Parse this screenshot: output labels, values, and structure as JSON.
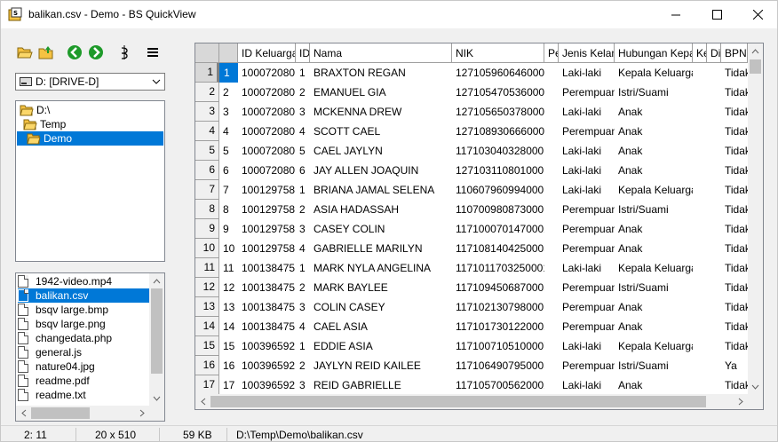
{
  "window": {
    "title": "balikan.csv - Demo - BS QuickView"
  },
  "toolbar": {
    "buttons": [
      "open-folder-icon",
      "up-folder-icon",
      "back-icon",
      "forward-icon",
      "wrap-icon",
      "menu-icon"
    ]
  },
  "drive": {
    "selected": "D: [DRIVE-D]"
  },
  "tree": {
    "items": [
      {
        "label": "D:\\",
        "depth": 0,
        "selected": false
      },
      {
        "label": "Temp",
        "depth": 1,
        "selected": false
      },
      {
        "label": "Demo",
        "depth": 2,
        "selected": true
      }
    ]
  },
  "files": {
    "items": [
      {
        "label": "1942-video.mp4",
        "selected": false
      },
      {
        "label": "balikan.csv",
        "selected": true
      },
      {
        "label": "bsqv large.bmp",
        "selected": false
      },
      {
        "label": "bsqv large.png",
        "selected": false
      },
      {
        "label": "changedata.php",
        "selected": false
      },
      {
        "label": "general.js",
        "selected": false
      },
      {
        "label": "nature04.jpg",
        "selected": false
      },
      {
        "label": "readme.pdf",
        "selected": false
      },
      {
        "label": "readme.txt",
        "selected": false
      }
    ]
  },
  "grid": {
    "columns": [
      "ID Keluarga",
      "ID",
      "Nama",
      "NIK",
      "Pe",
      "Jenis Kelamin",
      "Hubungan Kepala Keluarga",
      "Ke",
      "Di",
      "BPNT"
    ],
    "rows": [
      {
        "n": "1",
        "cells": [
          "1",
          "100072080",
          "1",
          "BRAXTON REGAN",
          "1271059606460001",
          "",
          "Laki-laki",
          "Kepala Keluarga",
          "",
          "",
          "Tidak"
        ]
      },
      {
        "n": "2",
        "cells": [
          "2",
          "100072080",
          "2",
          "EMANUEL GIA",
          "1271054705360001",
          "",
          "Perempuan",
          "Istri/Suami",
          "",
          "",
          "Tidak"
        ]
      },
      {
        "n": "3",
        "cells": [
          "3",
          "100072080",
          "3",
          "MCKENNA DREW",
          "1271056503780001",
          "",
          "Laki-laki",
          "Anak",
          "",
          "",
          "Tidak"
        ]
      },
      {
        "n": "4",
        "cells": [
          "4",
          "100072080",
          "4",
          "SCOTT CAEL",
          "1271089306660001",
          "",
          "Perempuan",
          "Anak",
          "",
          "",
          "Tidak"
        ]
      },
      {
        "n": "5",
        "cells": [
          "5",
          "100072080",
          "5",
          "CAEL JAYLYN",
          "1171030403280001",
          "",
          "Laki-laki",
          "Anak",
          "",
          "",
          "Tidak"
        ]
      },
      {
        "n": "6",
        "cells": [
          "6",
          "100072080",
          "6",
          "JAY ALLEN JOAQUIN",
          "1271031108010001",
          "",
          "Laki-laki",
          "Anak",
          "",
          "",
          "Tidak"
        ]
      },
      {
        "n": "7",
        "cells": [
          "7",
          "100129758",
          "1",
          "BRIANA JAMAL SELENA",
          "1106079609940001",
          "",
          "Laki-laki",
          "Kepala Keluarga",
          "",
          "",
          "Tidak"
        ]
      },
      {
        "n": "8",
        "cells": [
          "8",
          "100129758",
          "2",
          "ASIA HADASSAH",
          "1107009808730001",
          "",
          "Perempuan",
          "Istri/Suami",
          "",
          "",
          "Tidak"
        ]
      },
      {
        "n": "9",
        "cells": [
          "9",
          "100129758",
          "3",
          "CASEY COLIN",
          "1171000701470002",
          "",
          "Perempuan",
          "Anak",
          "",
          "",
          "Tidak"
        ]
      },
      {
        "n": "10",
        "cells": [
          "10",
          "100129758",
          "4",
          "GABRIELLE MARILYN",
          "1171081404250003",
          "",
          "Perempuan",
          "Anak",
          "",
          "",
          "Tidak"
        ]
      },
      {
        "n": "11",
        "cells": [
          "11",
          "100138475",
          "1",
          "MARK NYLA ANGELINA",
          "1171011703250001",
          "",
          "Laki-laki",
          "Kepala Keluarga",
          "",
          "",
          "Tidak"
        ]
      },
      {
        "n": "12",
        "cells": [
          "12",
          "100138475",
          "2",
          "MARK BAYLEE",
          "1171094506870005",
          "",
          "Perempuan",
          "Istri/Suami",
          "",
          "",
          "Tidak"
        ]
      },
      {
        "n": "13",
        "cells": [
          "13",
          "100138475",
          "3",
          "COLIN CASEY",
          "1171021307980001",
          "",
          "Perempuan",
          "Anak",
          "",
          "",
          "Tidak"
        ]
      },
      {
        "n": "14",
        "cells": [
          "14",
          "100138475",
          "4",
          "CAEL ASIA",
          "1171017301220002",
          "",
          "Perempuan",
          "Anak",
          "",
          "",
          "Tidak"
        ]
      },
      {
        "n": "15",
        "cells": [
          "15",
          "100396592",
          "1",
          "EDDIE ASIA",
          "1171007105100007",
          "",
          "Laki-laki",
          "Kepala Keluarga",
          "",
          "",
          "Tidak"
        ]
      },
      {
        "n": "16",
        "cells": [
          "16",
          "100396592",
          "2",
          "JAYLYN REID KAILEE",
          "1171064907950003",
          "",
          "Perempuan",
          "Istri/Suami",
          "",
          "",
          "Ya"
        ]
      },
      {
        "n": "17",
        "cells": [
          "17",
          "100396592",
          "3",
          "REID GABRIELLE",
          "1171057005620002",
          "",
          "Laki-laki",
          "Anak",
          "",
          "",
          "Tidak"
        ]
      }
    ]
  },
  "status": {
    "position": "2: 11",
    "dimensions": "20 x 510",
    "size": "59 KB",
    "path": "D:\\Temp\\Demo\\balikan.csv"
  },
  "colors": {
    "selection": "#0078d7",
    "window_bg": "#f0f0f0",
    "green_nav": "#1e9a2a",
    "folder_yellow": "#f5c242"
  }
}
